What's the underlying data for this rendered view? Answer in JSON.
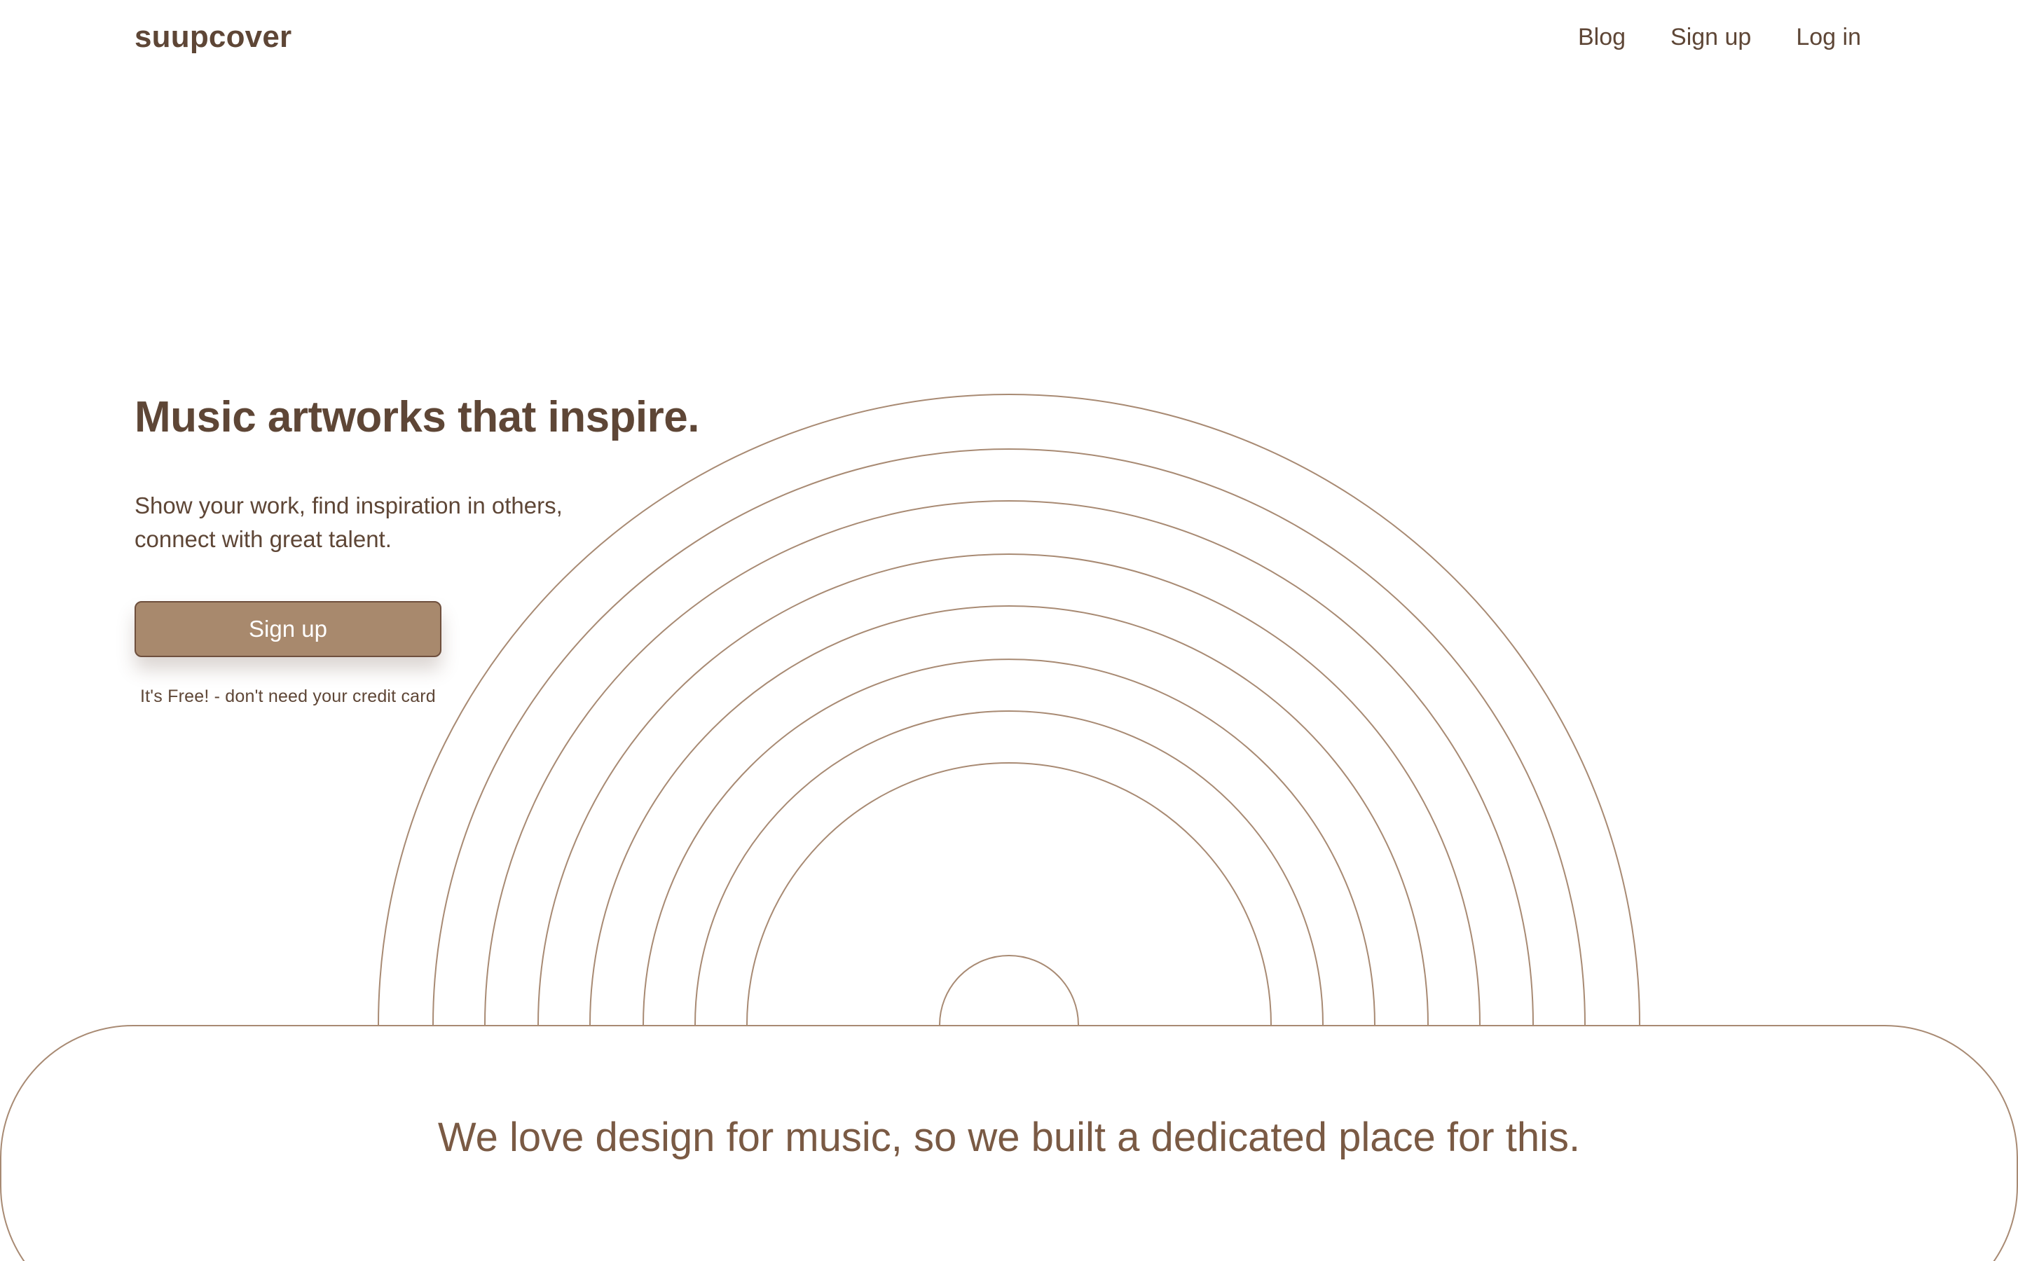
{
  "header": {
    "logo": "suupcover",
    "nav": {
      "blog": "Blog",
      "signup": "Sign up",
      "login": "Log in"
    }
  },
  "hero": {
    "title": "Music artworks that inspire.",
    "subtitle_line1": "Show your work, find inspiration in others,",
    "subtitle_line2": "connect with great talent.",
    "cta_label": "Sign up",
    "note": "It's Free! - don't need your credit card"
  },
  "section": {
    "headline": "We love design for music, so we built a dedicated place for this."
  },
  "colors": {
    "text": "#5e4636",
    "accent": "#a8896d",
    "line": "#a88a73",
    "background": "#ffffff"
  }
}
